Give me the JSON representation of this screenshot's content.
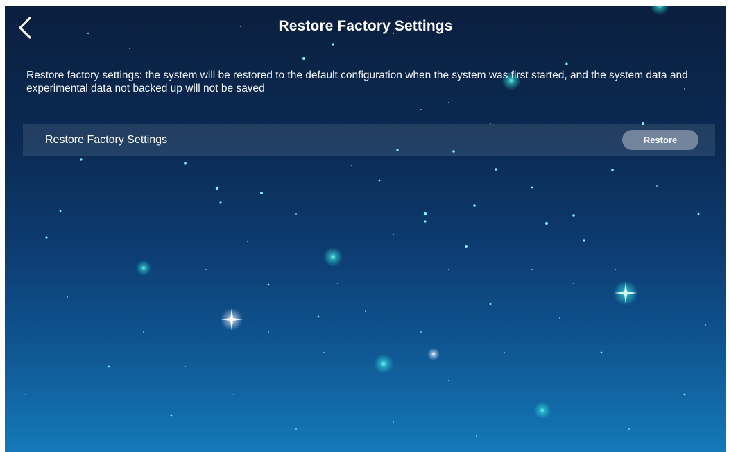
{
  "header": {
    "back_icon": "chevron-left-icon",
    "title": "Restore Factory Settings"
  },
  "description": "Restore factory settings: the system will be restored to the default configuration when the system was first started, and the system data and experimental data not backed up will not be saved",
  "settings": {
    "restore_row": {
      "label": "Restore Factory Settings",
      "button_label": "Restore"
    }
  },
  "colors": {
    "background_top": "#0b1f3f",
    "background_bottom": "#1479b8",
    "star_glow": "#3ff0e6",
    "text": "#ffffff",
    "button": "#aab4c3"
  }
}
